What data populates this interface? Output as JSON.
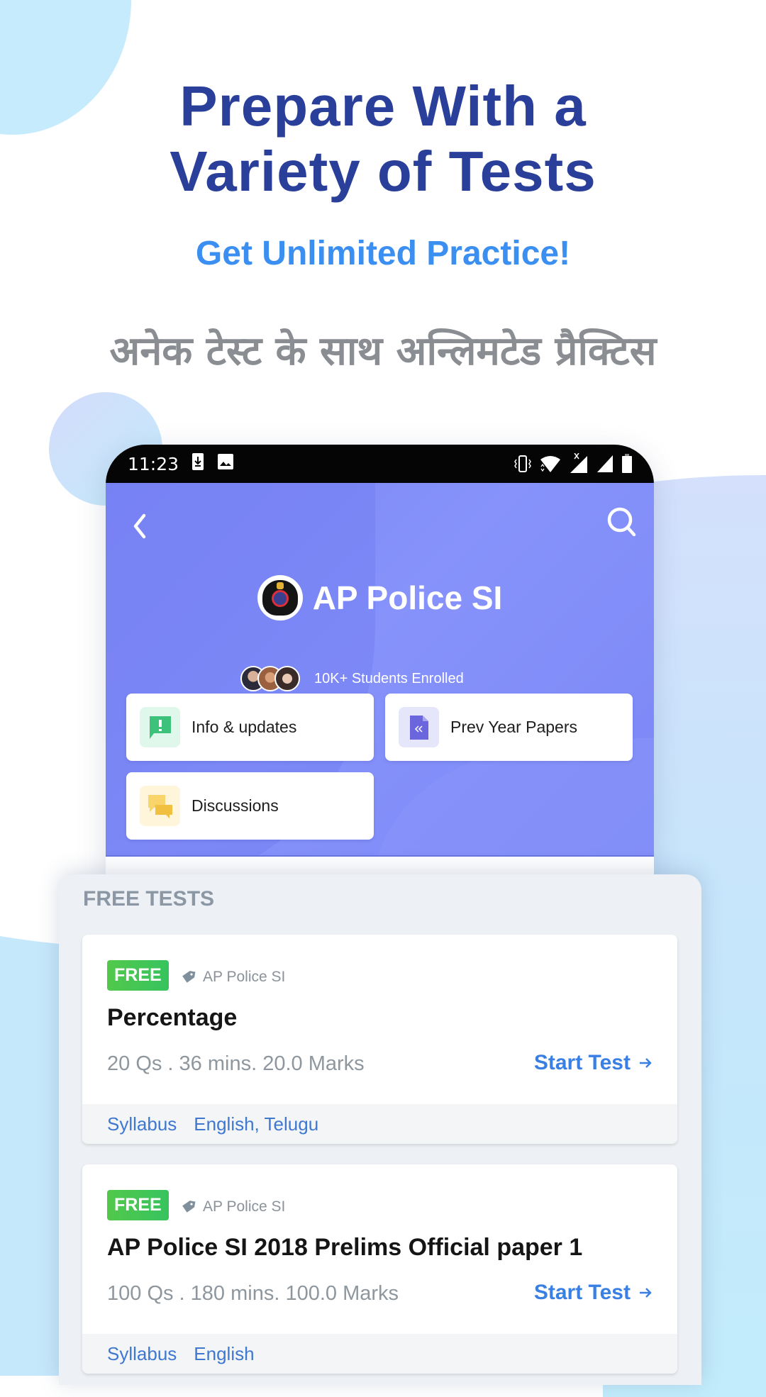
{
  "promo": {
    "headline_line1": "Prepare With a",
    "headline_line2": "Variety of Tests",
    "subheadline": "Get Unlimited Practice!",
    "hindi_tagline": "अनेक टेस्ट के साथ अन्लिमटेड प्रैक्टिस",
    "colors": {
      "headline": "#2a3f9a",
      "subheadline": "#3b8ff0",
      "hindi": "#8a8d91"
    }
  },
  "status_bar": {
    "time": "11:23",
    "left_icons": [
      "download-icon",
      "image-icon"
    ],
    "right_icons": [
      "vibrate-icon",
      "wifi-icon",
      "signal-x-icon",
      "signal-icon",
      "battery-icon"
    ]
  },
  "header": {
    "back_icon": "chevron-left-icon",
    "search_icon": "search-icon",
    "course_title": "AP Police SI",
    "logo": "ap-police-logo",
    "enrolled_text": "10K+ Students Enrolled",
    "accent": "#7c87f6"
  },
  "tiles": [
    {
      "label": "Info & updates",
      "icon": "info-alert-icon",
      "icon_bg": "#e0f7ec",
      "icon_color": "#3cc27a"
    },
    {
      "label": "Prev Year Papers",
      "icon": "document-icon",
      "icon_bg": "#e6e6fb",
      "icon_color": "#6b66dd"
    },
    {
      "label": "Discussions",
      "icon": "chat-icon",
      "icon_bg": "#fff5da",
      "icon_color": "#f6c94c"
    }
  ],
  "free_tests": {
    "section_title": "FREE TESTS",
    "tests": [
      {
        "badge": "FREE",
        "tag": "AP Police SI",
        "title": "Percentage",
        "meta": "20 Qs . 36 mins. 20.0 Marks",
        "action": "Start Test",
        "footer_label": "Syllabus",
        "footer_value": "English, Telugu"
      },
      {
        "badge": "FREE",
        "tag": "AP Police SI",
        "title": "AP Police SI 2018 Prelims Official paper 1",
        "meta": "100 Qs . 180 mins. 100.0 Marks",
        "action": "Start Test",
        "footer_label": "Syllabus",
        "footer_value": "English"
      }
    ]
  }
}
